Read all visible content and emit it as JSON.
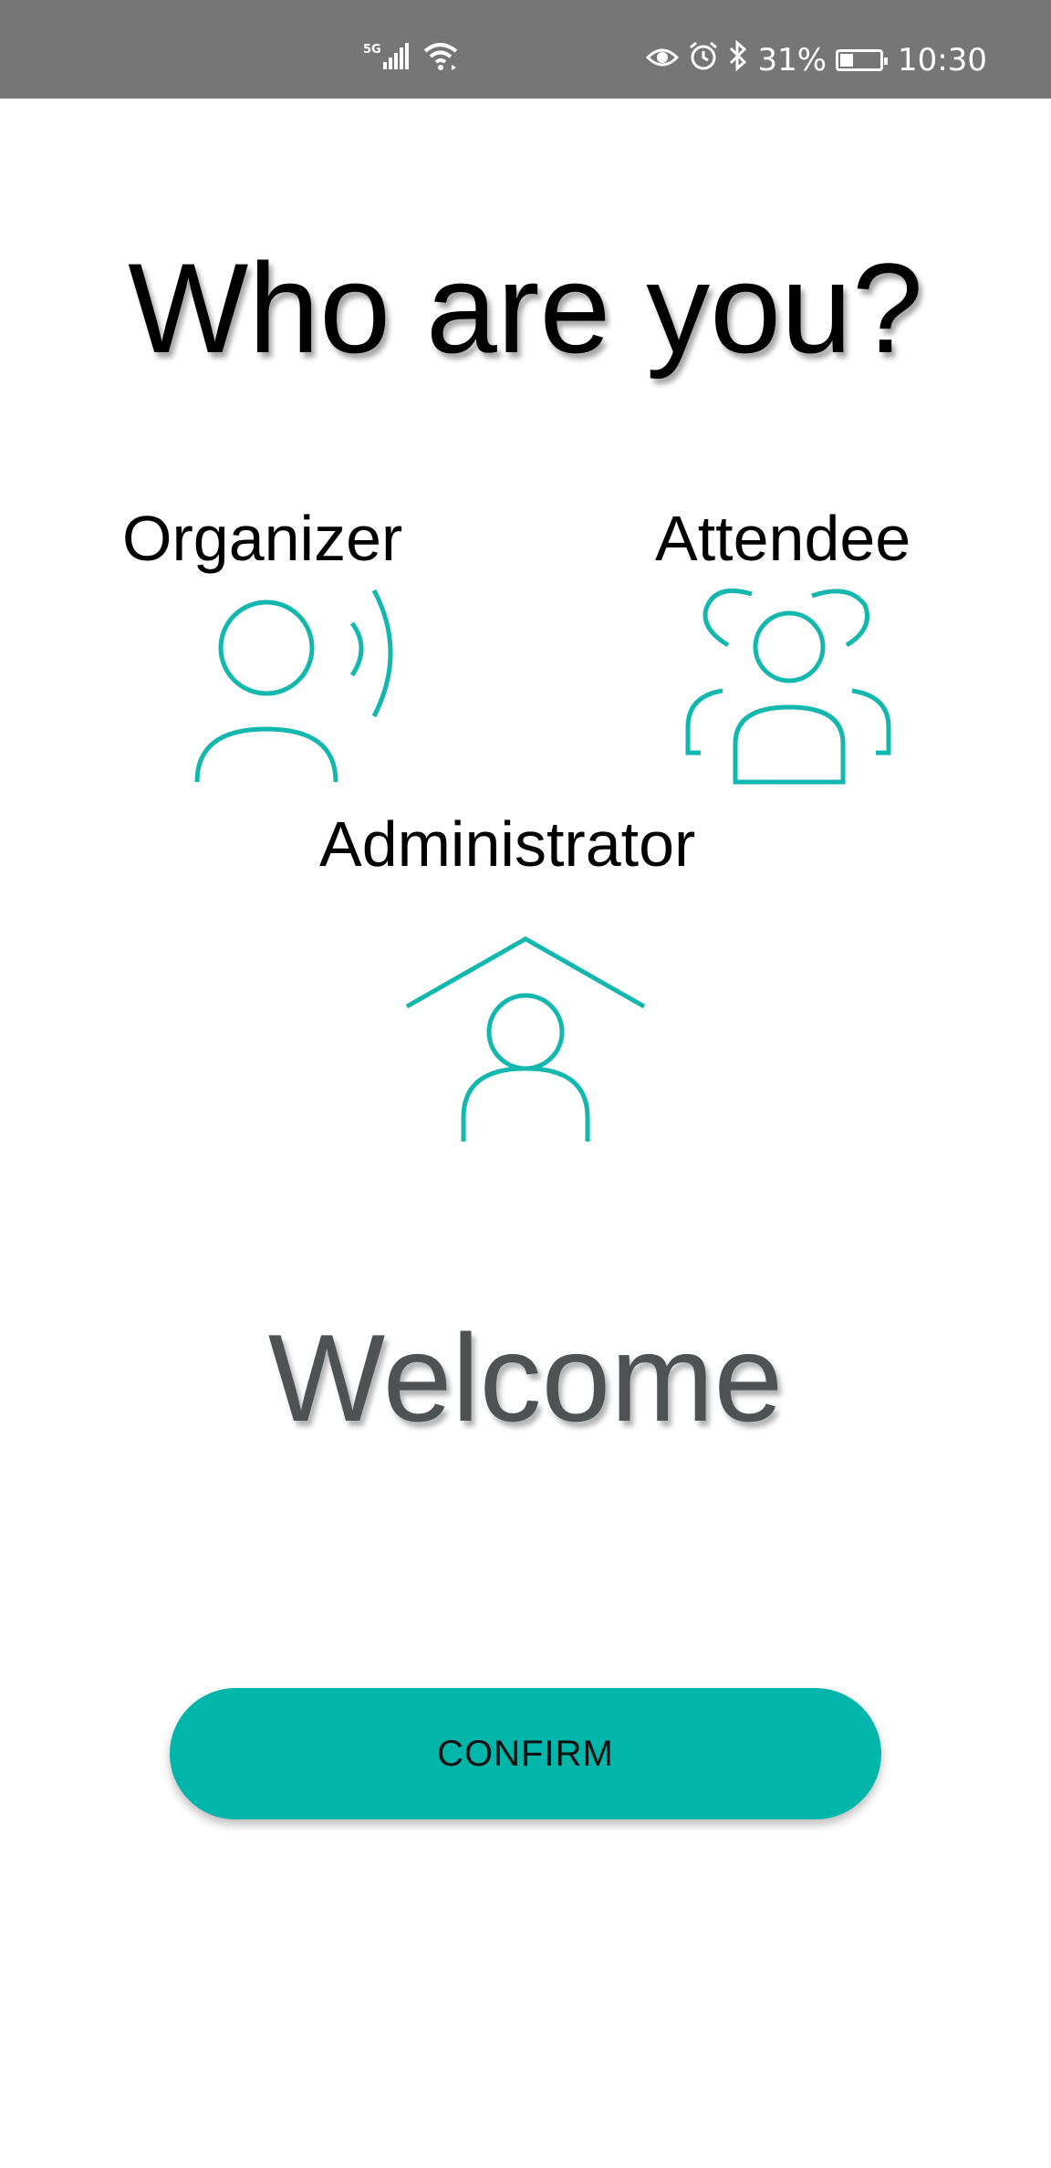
{
  "status_bar": {
    "network_label": "5G",
    "battery_percent": "31%",
    "time": "10:30",
    "icons": [
      "signal-icon",
      "wifi-icon",
      "eye-icon",
      "alarm-icon",
      "bluetooth-icon",
      "battery-icon"
    ]
  },
  "title": "Who are you?",
  "roles": [
    {
      "label": "Organizer",
      "icon": "organizer-icon"
    },
    {
      "label": "Attendee",
      "icon": "attendee-icon"
    },
    {
      "label": "Administrator",
      "icon": "administrator-icon"
    }
  ],
  "welcome_text": "Welcome",
  "confirm_label": "CONFIRM",
  "colors": {
    "accent": "#00b5a9",
    "status_bar": "#767676",
    "welcome_text": "#4e5252"
  }
}
